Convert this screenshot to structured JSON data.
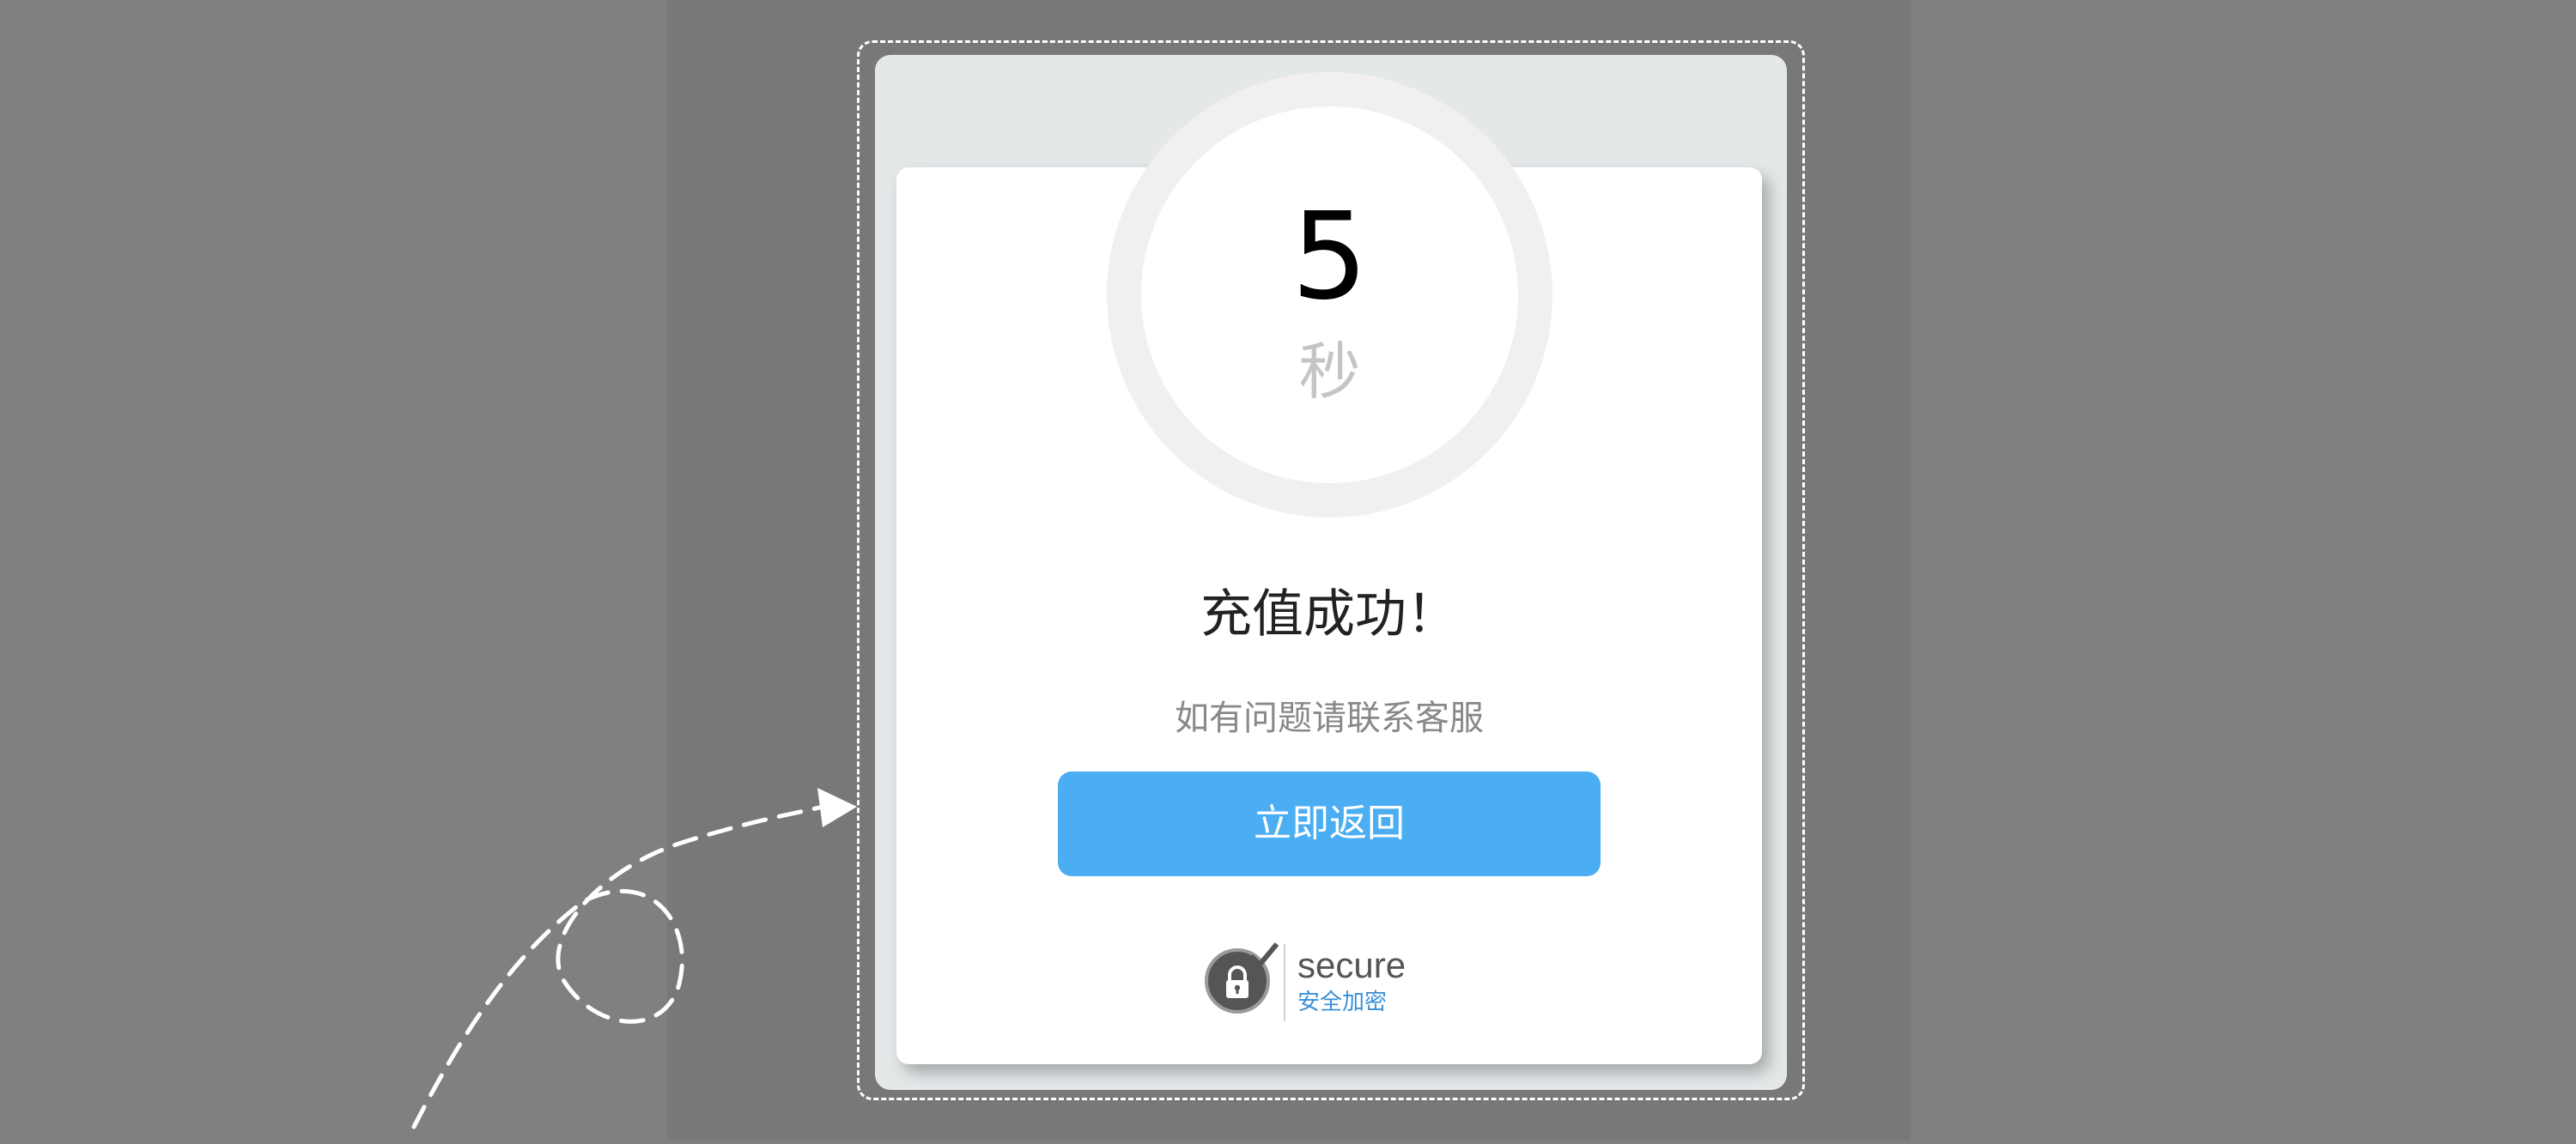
{
  "countdown": {
    "number": "5",
    "unit": "秒"
  },
  "result": {
    "title": "充值成功！",
    "subtitle": "如有问题请联系客服"
  },
  "actions": {
    "return_label": "立即返回"
  },
  "badge": {
    "word": "secure",
    "caption": "安全加密"
  },
  "colors": {
    "accent": "#4baef2",
    "ring": "#f2eff0",
    "badge_text": "#3a8fd6"
  }
}
